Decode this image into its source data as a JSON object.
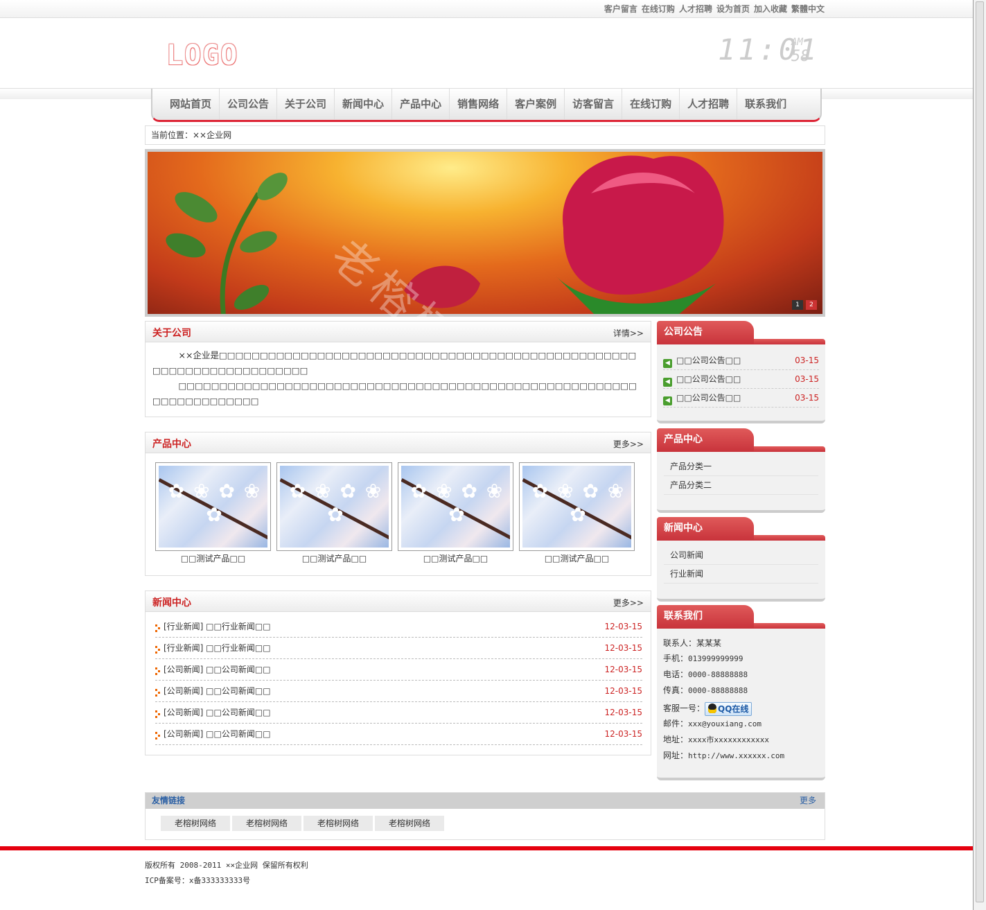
{
  "top_links": [
    "客户留言",
    "在线订购",
    "人才招聘",
    "设为首页",
    "加入收藏",
    "繁體中文"
  ],
  "logo_text": "LOGO",
  "clock": {
    "hm": "11:01",
    "ampm": "AM",
    "sec": "58"
  },
  "nav": [
    "网站首页",
    "公司公告",
    "关于公司",
    "新闻中心",
    "产品中心",
    "销售网络",
    "客户案例",
    "访客留言",
    "在线订购",
    "人才招聘",
    "联系我们"
  ],
  "breadcrumb": "当前位置：××企业网",
  "banner": {
    "dots": [
      "1",
      "2"
    ]
  },
  "watermark": "老榕树网络",
  "about": {
    "title": "关于公司",
    "more": "详情>>",
    "p1": "××企业是□□□□□□□□□□□□□□□□□□□□□□□□□□□□□□□□□□□□□□□□□□□□□□□□□□□□□□□□□□□□□□□□□□□□□□",
    "p2": "□□□□□□□□□□□□□□□□□□□□□□□□□□□□□□□□□□□□□□□□□□□□□□□□□□□□□□□□□□□□□□□□□□□□□"
  },
  "products": {
    "title": "产品中心",
    "more": "更多>>",
    "items": [
      "□□测试产品□□",
      "□□测试产品□□",
      "□□测试产品□□",
      "□□测试产品□□"
    ]
  },
  "news": {
    "title": "新闻中心",
    "more": "更多>>",
    "items": [
      {
        "text": "[行业新闻] □□行业新闻□□",
        "date": "12-03-15"
      },
      {
        "text": "[行业新闻] □□行业新闻□□",
        "date": "12-03-15"
      },
      {
        "text": "[公司新闻] □□公司新闻□□",
        "date": "12-03-15"
      },
      {
        "text": "[公司新闻] □□公司新闻□□",
        "date": "12-03-15"
      },
      {
        "text": "[公司新闻] □□公司新闻□□",
        "date": "12-03-15"
      },
      {
        "text": "[公司新闻] □□公司新闻□□",
        "date": "12-03-15"
      }
    ]
  },
  "side_notice": {
    "title": "公司公告",
    "items": [
      {
        "text": "□□公司公告□□",
        "date": "03-15"
      },
      {
        "text": "□□公司公告□□",
        "date": "03-15"
      },
      {
        "text": "□□公司公告□□",
        "date": "03-15"
      }
    ]
  },
  "side_products": {
    "title": "产品中心",
    "items": [
      "产品分类一",
      "产品分类二"
    ]
  },
  "side_news": {
    "title": "新闻中心",
    "items": [
      "公司新闻",
      "行业新闻"
    ]
  },
  "contact": {
    "title": "联系我们",
    "person": "联系人：某某某",
    "mobile_label": "手机：",
    "mobile": "013999999999",
    "phone_label": "电话：",
    "phone": "0000-88888888",
    "fax_label": "传真：",
    "fax": "0000-88888888",
    "service_label": "客服一号：",
    "qq": "QQ在线",
    "email_label": "邮件：",
    "email": "xxx@youxiang.com",
    "address_label": "地址：",
    "address": "xxxx市xxxxxxxxxxxx",
    "site_label": "网址：",
    "site": "http://www.xxxxxx.com"
  },
  "links": {
    "title": "友情链接",
    "more": "更多",
    "items": [
      "老榕树网络",
      "老榕树网络",
      "老榕树网络",
      "老榕树网络"
    ]
  },
  "footer": {
    "copyright": "版权所有 2008-2011 ××企业网 保留所有权利",
    "icp": "ICP备案号：x备333333333号"
  }
}
